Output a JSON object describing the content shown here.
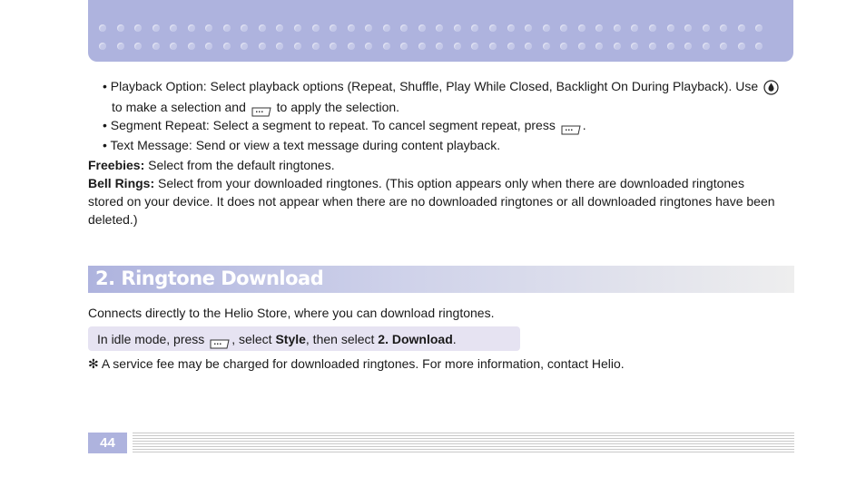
{
  "bullets": {
    "playback_line1": "• Playback Option: Select playback options (Repeat, Shuffle, Play While Closed, Backlight On During Playback). Use",
    "playback_line2a": "to make a selection and",
    "playback_line2b": "to apply the selection.",
    "segment_a": "• Segment Repeat: Select a segment to repeat. To cancel segment repeat, press",
    "segment_b": ".",
    "text_message": "• Text Message: Send or view a text message during content playback."
  },
  "freebies": {
    "label": "Freebies:",
    "text": " Select from the default ringtones."
  },
  "bell_rings": {
    "label": "Bell Rings:",
    "line1": " Select from your downloaded ringtones. (This option appears only when there are downloaded ringtones",
    "line2": "stored on your device. It does not appear when there are no downloaded ringtones or all downloaded ringtones have been",
    "line3": "deleted.)"
  },
  "section": {
    "title": "2. Ringtone Download",
    "intro": "Connects directly to the Helio Store, where you can download ringtones."
  },
  "instruction": {
    "part1": "In idle mode, press",
    "part2": ", select ",
    "style_label": "Style",
    "part3": ", then select ",
    "download_label": "2. Download",
    "part4": "."
  },
  "note": "✻ A service fee may be charged for downloaded ringtones. For more information, contact Helio.",
  "footer": {
    "page_number": "44"
  },
  "colors": {
    "accent": "#aeb3de",
    "instruction_bg": "#e6e3f2"
  },
  "icons": [
    "ok-key-icon",
    "left-softkey-icon",
    "right-softkey-icon"
  ]
}
